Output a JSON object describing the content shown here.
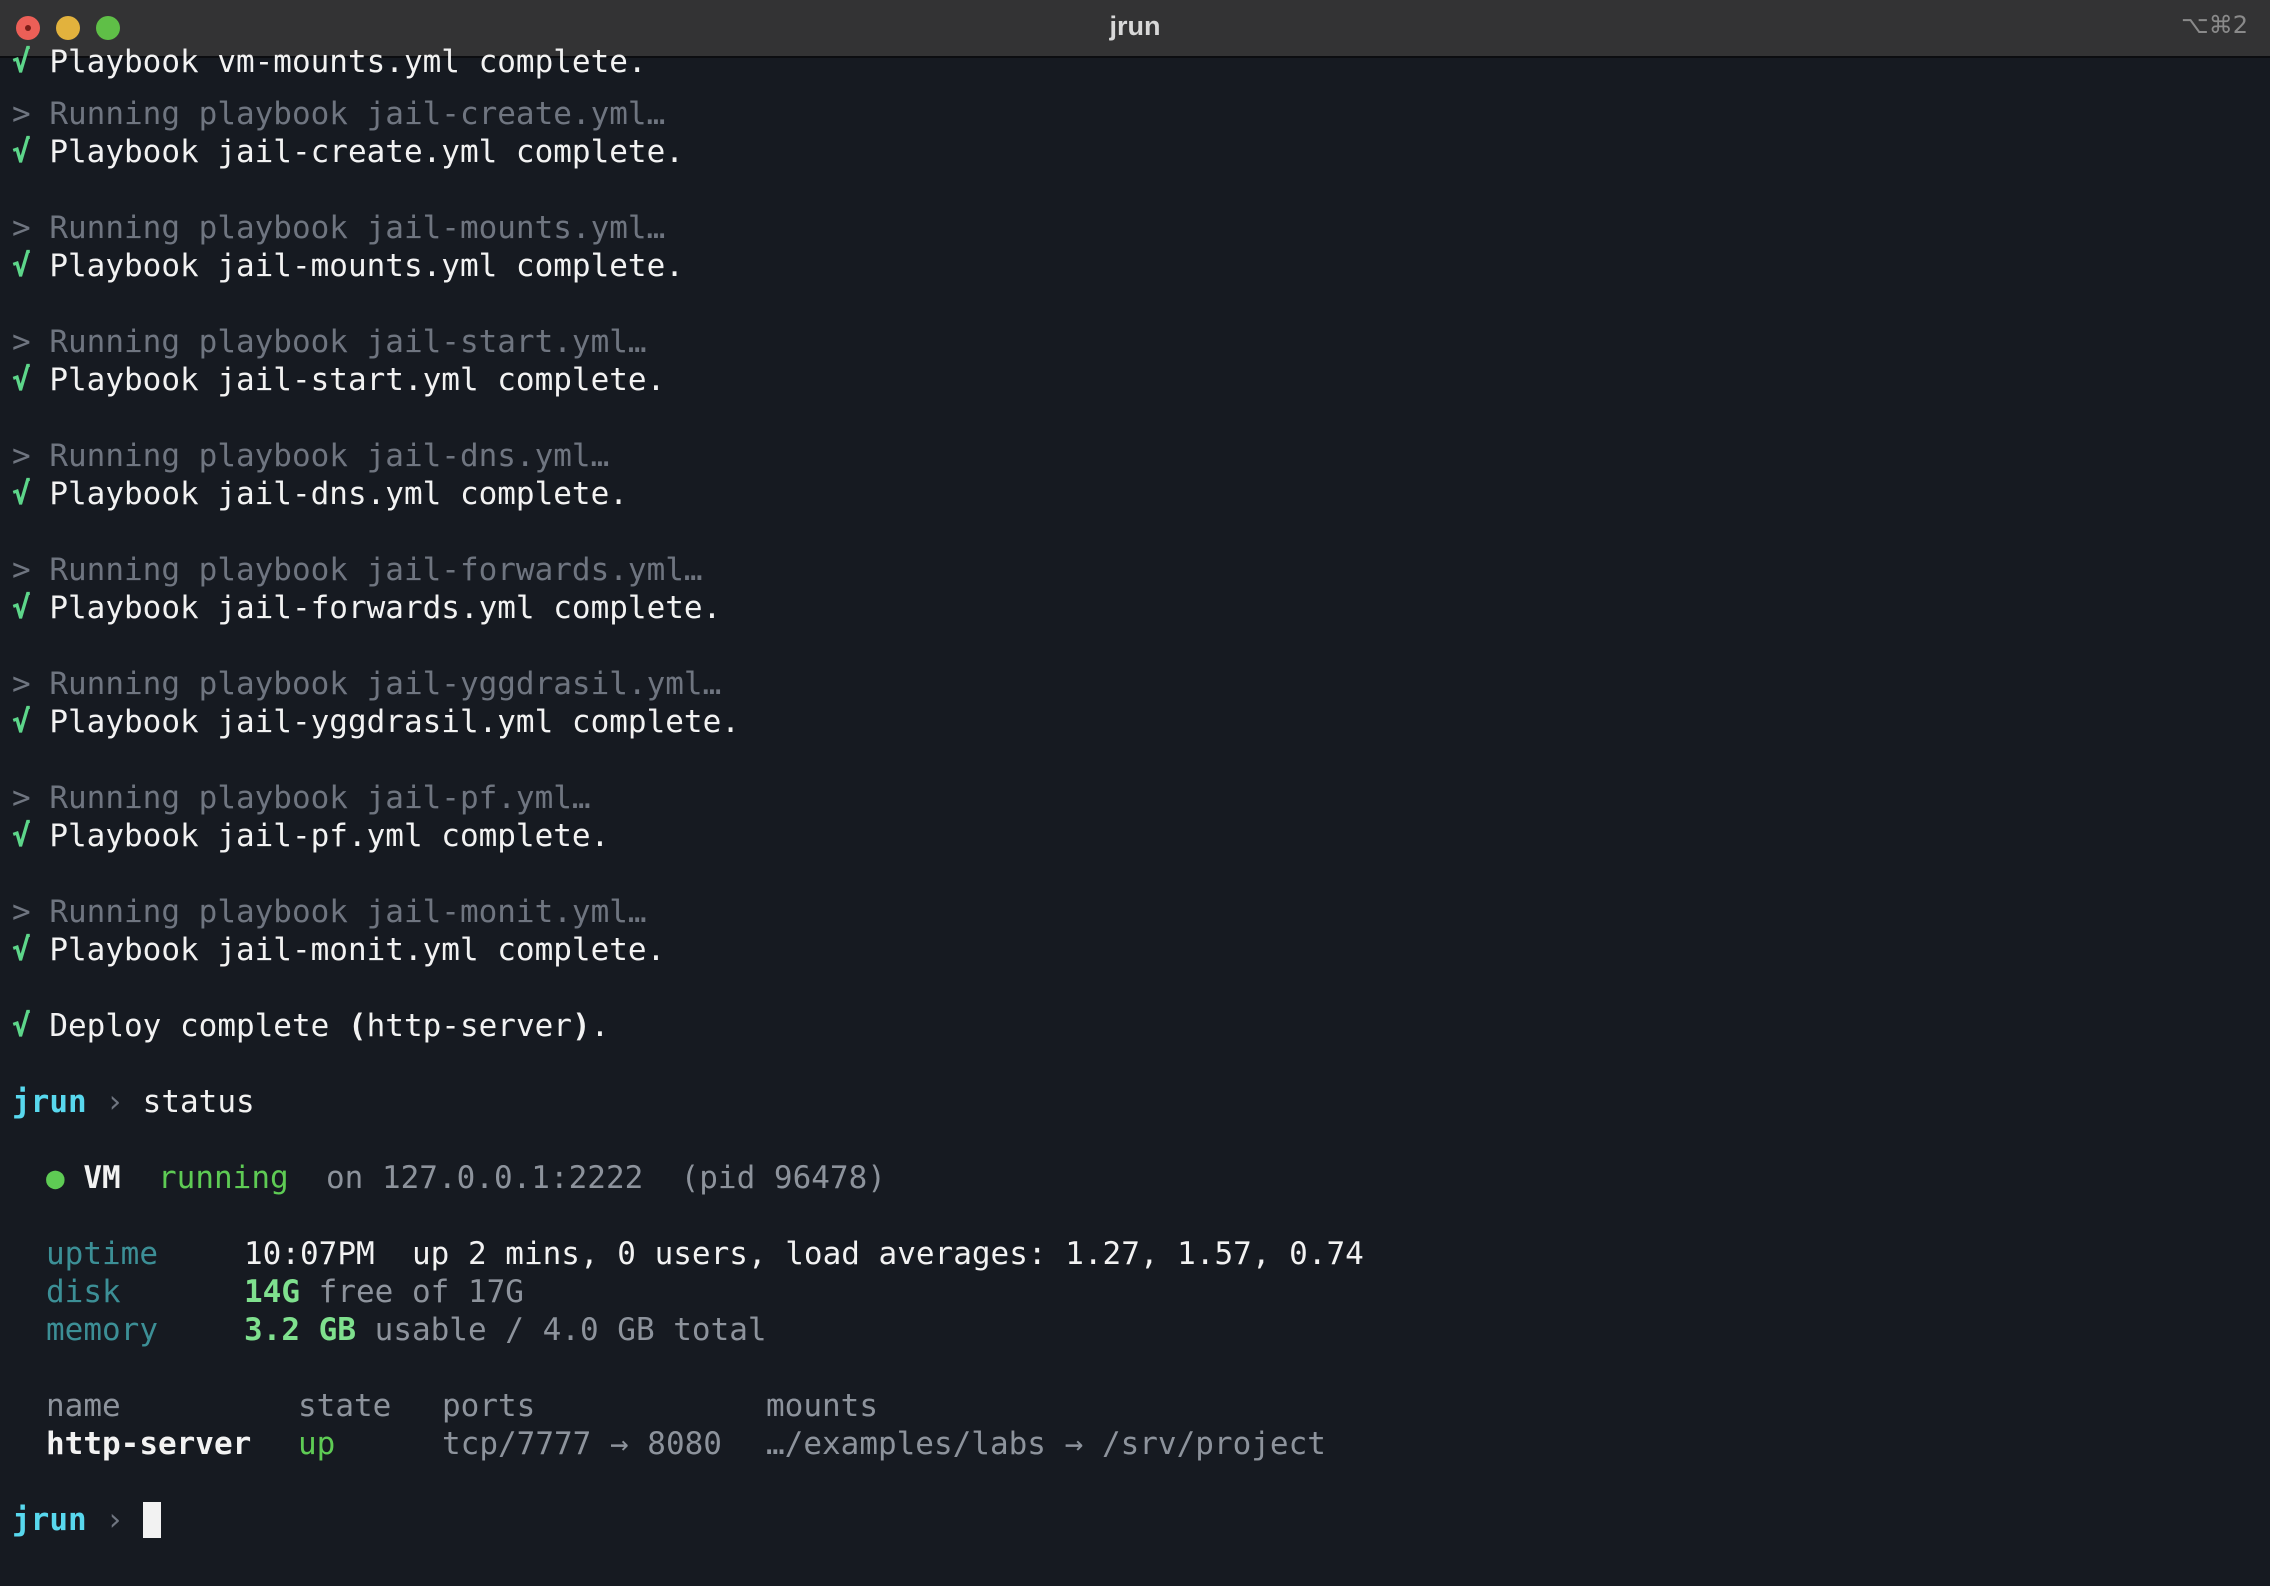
{
  "window": {
    "title": "jrun",
    "shortcut": "⌥⌘2"
  },
  "glyphs": {
    "check": "√",
    "run_marker": ">",
    "prompt_chevron": "›",
    "status_dot": "●"
  },
  "log": {
    "first_complete": "Playbook vm-mounts.yml complete.",
    "steps": [
      {
        "running": "Running playbook jail-create.yml…",
        "complete": "Playbook jail-create.yml complete."
      },
      {
        "running": "Running playbook jail-mounts.yml…",
        "complete": "Playbook jail-mounts.yml complete."
      },
      {
        "running": "Running playbook jail-start.yml…",
        "complete": "Playbook jail-start.yml complete."
      },
      {
        "running": "Running playbook jail-dns.yml…",
        "complete": "Playbook jail-dns.yml complete."
      },
      {
        "running": "Running playbook jail-forwards.yml…",
        "complete": "Playbook jail-forwards.yml complete."
      },
      {
        "running": "Running playbook jail-yggdrasil.yml…",
        "complete": "Playbook jail-yggdrasil.yml complete."
      },
      {
        "running": "Running playbook jail-pf.yml…",
        "complete": "Playbook jail-pf.yml complete."
      },
      {
        "running": "Running playbook jail-monit.yml…",
        "complete": "Playbook jail-monit.yml complete."
      }
    ],
    "deploy_prefix": "Deploy complete ",
    "deploy_open": "(",
    "deploy_target": "http-server",
    "deploy_close": ")",
    "deploy_end": "."
  },
  "prompt": {
    "name": "jrun",
    "command": "status"
  },
  "status": {
    "vm_label": "VM",
    "vm_state": "running",
    "vm_address": "on 127.0.0.1:2222",
    "vm_pid": "(pid 96478)",
    "uptime_label": "uptime",
    "uptime_value": "10:07PM  up 2 mins, 0 users, load averages: 1.27, 1.57, 0.74",
    "disk_label": "disk",
    "disk_free": "14G",
    "disk_rest": "free of 17G",
    "memory_label": "memory",
    "memory_usable": "3.2 GB",
    "memory_rest": "usable / 4.0 GB total"
  },
  "jails_table": {
    "headers": {
      "name": "name",
      "state": "state",
      "ports": "ports",
      "mounts": "mounts"
    },
    "rows": [
      {
        "name": "http-server",
        "state": "up",
        "ports": "tcp/7777 → 8080",
        "mounts": "…/examples/labs → /srv/project"
      }
    ]
  },
  "colors": {
    "background": "#161a21",
    "check": "#5dd68a",
    "prompt": "#58d8ee",
    "running": "#5ecb54",
    "label": "#3c8f96"
  }
}
